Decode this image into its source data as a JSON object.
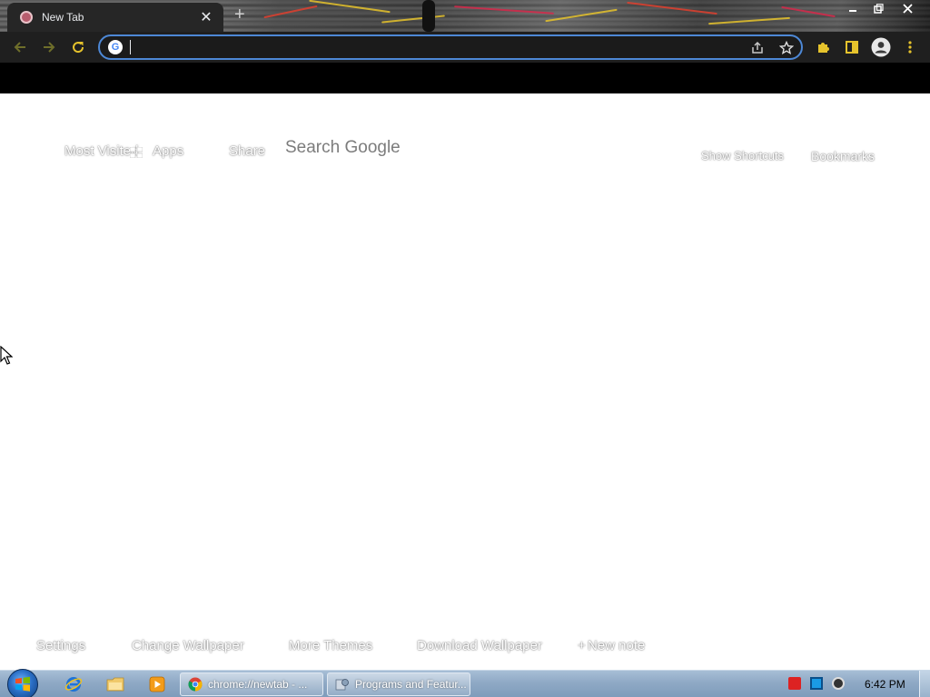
{
  "browser": {
    "tab": {
      "title": "New Tab"
    },
    "omnibox": {
      "value": "",
      "placeholder": ""
    }
  },
  "ntp": {
    "top_left_links": [
      "Most Visited",
      "Apps",
      "Share"
    ],
    "search_label": "Search Google",
    "top_right_links": [
      "Show Shortcuts",
      "Bookmarks"
    ],
    "bottom_links": [
      "Settings",
      "Change Wallpaper",
      "More Themes",
      "Download Wallpaper",
      "New note"
    ]
  },
  "taskbar": {
    "tasks": [
      {
        "label": "chrome://newtab - ..."
      },
      {
        "label": "Programs and Featur..."
      }
    ],
    "clock": "6:42 PM"
  },
  "colors": {
    "toolbar_bg": "#1f1f1f",
    "omnibox_border": "#4d88d6",
    "accent_yellow": "#e6c32c",
    "taskbar": "#8fa9c5"
  },
  "icons": [
    "back-arrow-icon",
    "forward-arrow-icon",
    "reload-icon",
    "google-g-icon",
    "share-icon",
    "star-icon",
    "extensions-puzzle-icon",
    "side-panel-icon",
    "profile-avatar-icon",
    "menu-dots-icon",
    "windows-start-orb-icon",
    "internet-explorer-icon",
    "folder-icon",
    "media-player-icon"
  ]
}
